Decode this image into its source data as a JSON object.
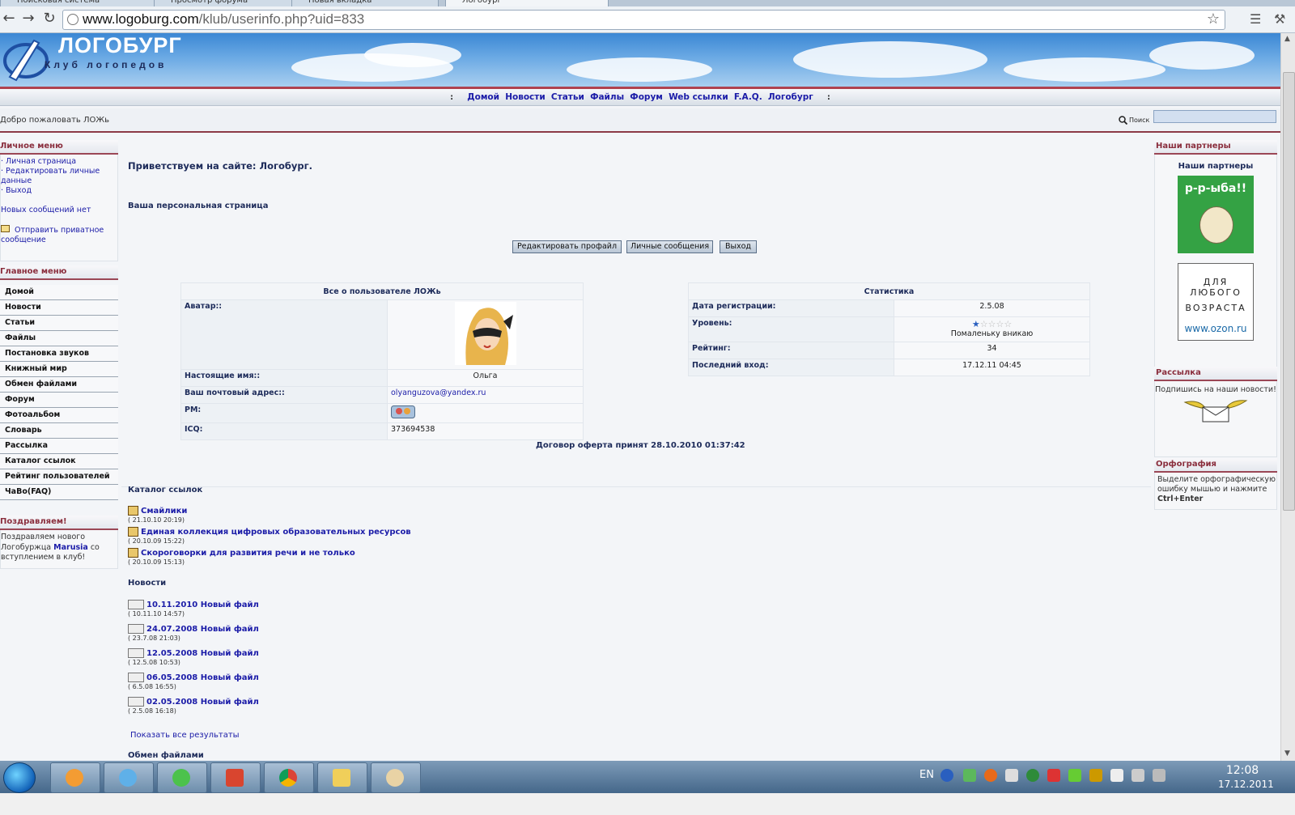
{
  "browser": {
    "tabs": [
      "Поисковая система",
      "Просмотр форума",
      "Новая вкладка",
      "Логобург"
    ],
    "url_host": "www.logoburg.com",
    "url_path": "/klub/userinfo.php?uid=833"
  },
  "site": {
    "name": "ЛОГОБУРГ",
    "tagline": "Клуб логопедов"
  },
  "topnav": [
    "Домой",
    "Новости",
    "Статьи",
    "Файлы",
    "Форум",
    "Web ссылки",
    "F.A.Q.",
    "Логобург"
  ],
  "welcome": "Добро пожаловать ЛОЖь",
  "search_label": "Поиск",
  "personal_menu": {
    "title": "Личное меню",
    "links": [
      "· Личная страница",
      "· Редактировать личные данные",
      "· Выход"
    ],
    "no_messages": "Новых сообщений нет",
    "send_private": "Отправить приватное сообщение"
  },
  "main_menu": {
    "title": "Главное меню",
    "items": [
      "Домой",
      "Новости",
      "Статьи",
      "Файлы",
      "Постановка звуков",
      "Книжный мир",
      "Обмен файлами",
      "Форум",
      "Фотоальбом",
      "Словарь",
      "Рассылка",
      "Каталог ссылок",
      "Рейтинг пользователей",
      "ЧаВо(FAQ)"
    ]
  },
  "congrats": {
    "title": "Поздравляем!",
    "text_before": "Поздравляем нового Логобуржца",
    "user": "Marusia",
    "text_after": "со вступлением в клуб!"
  },
  "partners": {
    "title": "Наши партнеры",
    "subtitle": "Наши партнеры",
    "banner1": "р-р-ыба!!",
    "banner2_line1": "ДЛЯ ЛЮБОГО",
    "banner2_line2": "ВОЗРАСТА",
    "banner2_url": "www.ozon.ru"
  },
  "mailing": {
    "title": "Рассылка",
    "text": "Подпишись на наши новости!"
  },
  "spelling": {
    "title": "Орфография",
    "text": "Выделите орфографическую ошибку мышью и нажмите",
    "keys": "Ctrl+Enter"
  },
  "center": {
    "greeting": "Приветствуем на сайте: Логобург.",
    "personal_page": "Ваша персональная страница",
    "buttons": [
      "Редактировать профайл",
      "Личные сообщения",
      "Выход"
    ],
    "user_table": {
      "title": "Все о пользователе ЛОЖь",
      "rows": [
        {
          "label": "Аватар::",
          "value": ""
        },
        {
          "label": "Настоящие имя::",
          "value": "Ольга"
        },
        {
          "label": "Ваш почтовый адрес::",
          "value": "olyanguzova@yandex.ru"
        },
        {
          "label": "PM:",
          "value": ""
        },
        {
          "label": "ICQ:",
          "value": "373694538"
        }
      ]
    },
    "stats_table": {
      "title": "Статистика",
      "rows": [
        {
          "label": "Дата регистрации:",
          "value": "2.5.08"
        },
        {
          "label": "Уровень:",
          "value": "Помаленьку вникаю"
        },
        {
          "label": "Рейтинг:",
          "value": "34"
        },
        {
          "label": "Последний вход:",
          "value": "17.12.11 04:45"
        }
      ],
      "level_stars": 1,
      "level_max": 5
    },
    "offer": "Договор оферта принят 28.10.2010 01:37:42",
    "catalog": {
      "title": "Каталог ссылок",
      "items": [
        {
          "title": "Смайлики",
          "date": "( 21.10.10 20:19)"
        },
        {
          "title": "Единая коллекция цифровых образовательных ресурсов",
          "date": "( 20.10.09 15:22)"
        },
        {
          "title": "Скороговорки для развития речи и не только",
          "date": "( 20.10.09 15:13)"
        }
      ]
    },
    "news": {
      "title": "Новости",
      "items": [
        {
          "title": "10.11.2010 Новый файл",
          "date": "( 10.11.10 14:57)"
        },
        {
          "title": "24.07.2008 Новый файл",
          "date": "( 23.7.08 21:03)"
        },
        {
          "title": "12.05.2008 Новый файл",
          "date": "( 12.5.08 10:53)"
        },
        {
          "title": "06.05.2008 Новый файл",
          "date": "( 6.5.08 16:55)"
        },
        {
          "title": "02.05.2008 Новый файл",
          "date": "( 2.5.08 16:18)"
        }
      ],
      "show_all": "Показать все результаты"
    },
    "file_exchange": "Обмен файлами"
  },
  "taskbar": {
    "lang": "EN",
    "time": "12:08",
    "date": "17.12.2011"
  },
  "colors": {
    "accent_red": "#9b4756",
    "link_blue": "#1b1ca8"
  }
}
